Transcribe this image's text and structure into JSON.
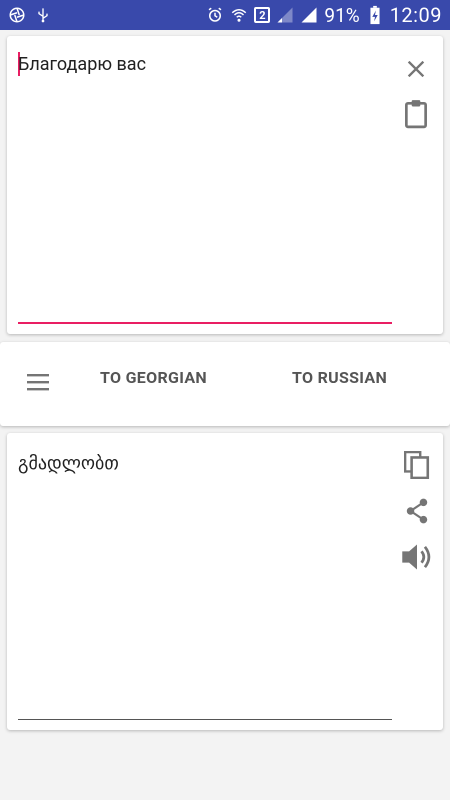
{
  "status_bar": {
    "battery": "91%",
    "time": "12:09",
    "sim_badge": "2"
  },
  "input": {
    "text": "Благодарю вас",
    "icons": [
      "close-icon",
      "clipboard-icon"
    ]
  },
  "controls": {
    "to_georgian": "TO GEORGIAN",
    "to_russian": "TO RUSSIAN",
    "menu_icon": "menu-icon"
  },
  "output": {
    "text": "გმადლობთ",
    "icons": [
      "copy-icon",
      "share-icon",
      "volume-icon"
    ]
  },
  "colors": {
    "status_bar": "#3949ab",
    "accent": "#e91e63",
    "icon": "#757575"
  }
}
